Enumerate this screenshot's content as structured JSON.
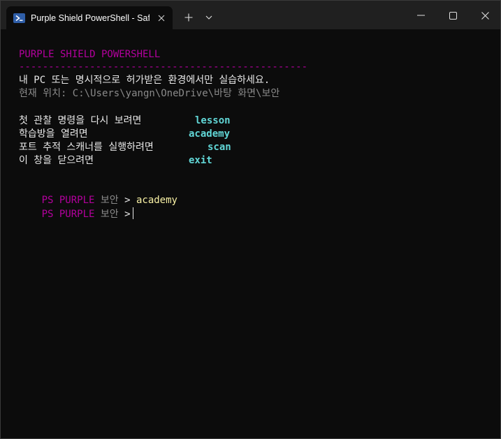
{
  "window": {
    "tab_title": "Purple Shield PowerShell - Saf",
    "tab_icon": "powershell-icon",
    "new_tab_symbol": "+",
    "buttons": [
      "minimize-icon",
      "maximize-icon",
      "close-icon"
    ]
  },
  "colors": {
    "banner": "#b4009e",
    "command": "#61d6d6",
    "input": "#f9f1a5",
    "text": "#e8e8e8",
    "dim": "#8a8a8a",
    "background": "#0c0c0c"
  },
  "banner": {
    "title": "PURPLE SHIELD POWERSHELL",
    "rule": "-------------------------------------------------",
    "warning": "내 PC 또는 명시적으로 허가받은 환경에서만 실습하세요.",
    "location": "현재 위치: C:\\Users\\yangn\\OneDrive\\바탕 화면\\보안"
  },
  "menu": [
    {
      "label": "첫 관찰 명령을 다시 보려면",
      "command": "lesson"
    },
    {
      "label": "학습방을 열려면",
      "command": "academy"
    },
    {
      "label": "포트 추적 스캐너를 실행하려면",
      "command": "scan"
    },
    {
      "label": "이 창을 닫으려면",
      "command": "exit"
    }
  ],
  "prompt": {
    "ps": "PS",
    "name": "PURPLE",
    "dir": "보안",
    "arrow": ">",
    "history": [
      "academy"
    ]
  }
}
